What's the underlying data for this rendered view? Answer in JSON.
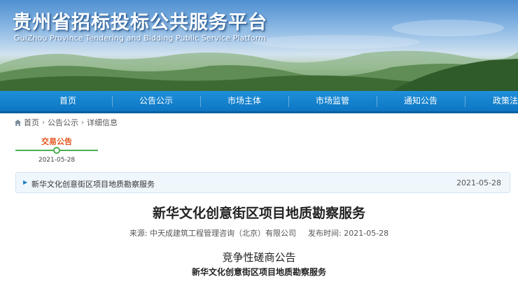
{
  "header": {
    "title": "贵州省招标投标公共服务平台",
    "subtitle": "GuiZhou Province Tendering and Bidding Public Service Platform"
  },
  "nav": {
    "items": [
      "首页",
      "公告公示",
      "市场主体",
      "市场监管",
      "通知公告",
      "政策法"
    ]
  },
  "breadcrumb": {
    "home": "首页",
    "level1": "公告公示",
    "current": "详细信息",
    "separator": "›"
  },
  "timeline": {
    "label": "交易公告",
    "date": "2021-05-28"
  },
  "info_bar": {
    "title": "新华文化创意街区项目地质勘察服务",
    "date": "2021-05-28"
  },
  "article": {
    "title": "新华文化创意街区项目地质勘察服务",
    "source_label": "来源:",
    "source": "中天成建筑工程管理咨询（北京）有限公司",
    "published_label": "发布时间:",
    "published": "2021-05-28",
    "body_heading": "竞争性磋商公告",
    "body_subheading": "新华文化创意街区项目地质勘察服务"
  },
  "colors": {
    "nav_bg": "#0d76c4",
    "accent_orange": "#e2571e",
    "timeline_green": "#4caf50",
    "info_bar_bg": "#f0f7fc"
  }
}
